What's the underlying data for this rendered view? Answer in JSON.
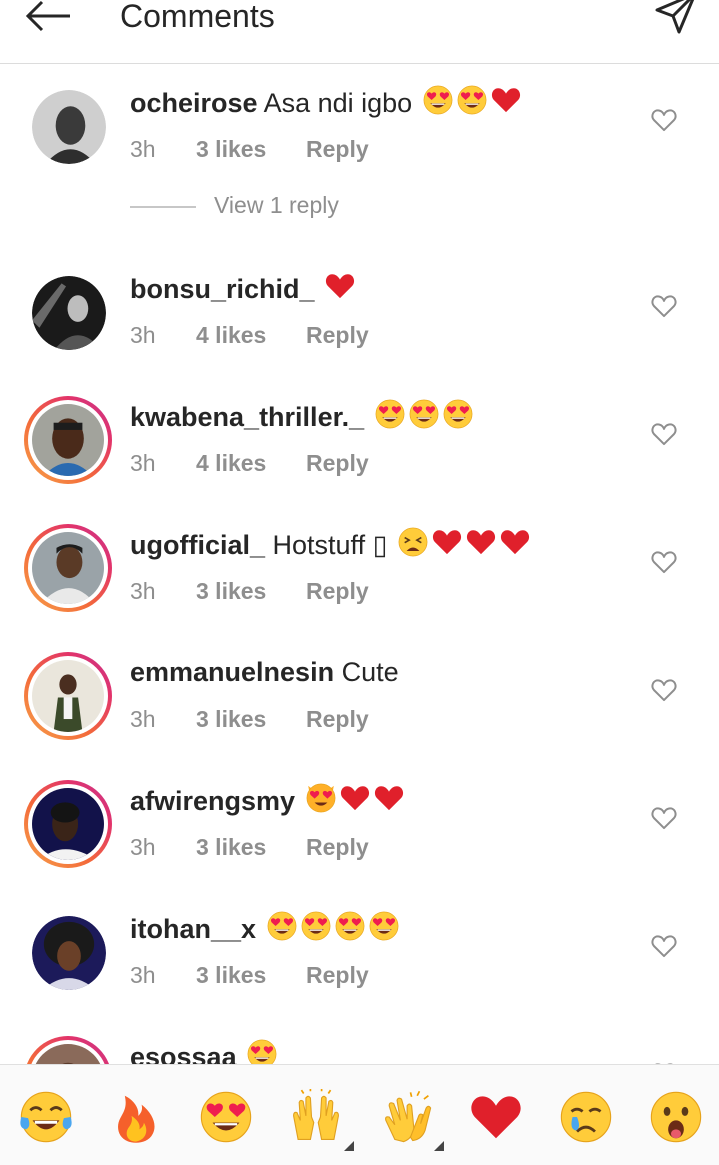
{
  "header": {
    "title": "Comments"
  },
  "comments": [
    {
      "username": "ocheirose",
      "text": "Asa ndi igbo",
      "emojis": [
        "heart-eyes",
        "heart-eyes",
        "red-heart"
      ],
      "time": "3h",
      "likes": "3 likes",
      "reply": "Reply",
      "ring": false
    },
    {
      "username": "bonsu_richid_",
      "text": "",
      "emojis": [
        "red-heart"
      ],
      "time": "3h",
      "likes": "4 likes",
      "reply": "Reply",
      "ring": false
    },
    {
      "username": "kwabena_thriller._",
      "text": "",
      "emojis": [
        "heart-eyes",
        "heart-eyes",
        "heart-eyes"
      ],
      "time": "3h",
      "likes": "4 likes",
      "reply": "Reply",
      "ring": true
    },
    {
      "username": "ugofficial_",
      "text": "Hotstuff ▯",
      "emojis": [
        "weary",
        "red-heart",
        "red-heart",
        "red-heart"
      ],
      "time": "3h",
      "likes": "3 likes",
      "reply": "Reply",
      "ring": true
    },
    {
      "username": "emmanuelnesin",
      "text": "Cute",
      "emojis": [],
      "time": "3h",
      "likes": "3 likes",
      "reply": "Reply",
      "ring": true
    },
    {
      "username": "afwirengsmy",
      "text": "",
      "emojis": [
        "cat-heart-eyes",
        "red-heart",
        "red-heart"
      ],
      "time": "3h",
      "likes": "3 likes",
      "reply": "Reply",
      "ring": true
    },
    {
      "username": "itohan__x",
      "text": "",
      "emojis": [
        "heart-eyes",
        "heart-eyes",
        "heart-eyes",
        "heart-eyes"
      ],
      "time": "3h",
      "likes": "3 likes",
      "reply": "Reply",
      "ring": false
    },
    {
      "username": "esossaa",
      "text": "",
      "emojis": [
        "heart-eyes"
      ],
      "time": "",
      "likes": "",
      "reply": "",
      "ring": true
    }
  ],
  "view_replies": {
    "label": "View 1 reply"
  },
  "emoji_bar": [
    "tears-of-joy",
    "fire",
    "heart-eyes",
    "raising-hands",
    "clapping-hands",
    "red-heart",
    "crying-face",
    "astonished-face"
  ],
  "colors": {
    "text": "#262626",
    "muted": "#8e8e8e",
    "heart": "#e0202b",
    "ring_start": "#f7a34b",
    "ring_end": "#c33691"
  }
}
